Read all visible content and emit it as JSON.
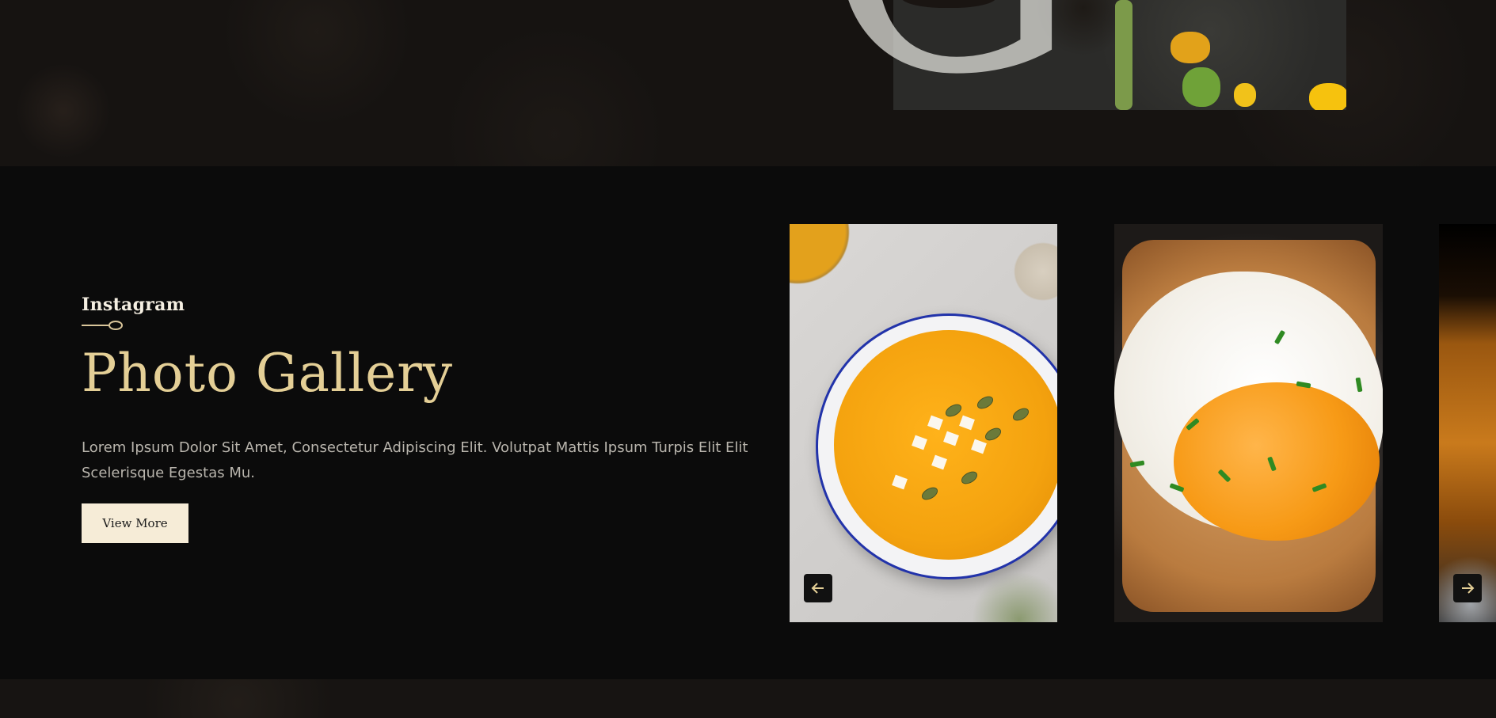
{
  "section": {
    "eyebrow": "Instagram",
    "title": "Photo Gallery",
    "description": "Lorem Ipsum Dolor Sit Amet, Consectetur Adipiscing Elit. Volutpat Mattis Ipsum Turpis Elit Elit Scelerisque Egestas Mu.",
    "button_label": "View More"
  },
  "gallery": {
    "tiles": [
      {
        "name": "pumpkin-soup-photo"
      },
      {
        "name": "fried-egg-toast-photo"
      },
      {
        "name": "drink-photo"
      }
    ],
    "prev_icon": "arrow-left-icon",
    "next_icon": "arrow-right-icon"
  },
  "colors": {
    "accent_gold": "#e4cf96",
    "button_bg": "#f6ecd7",
    "page_bg": "#0b0b0b"
  }
}
